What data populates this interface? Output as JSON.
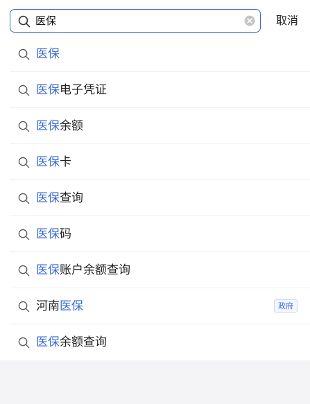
{
  "search": {
    "value": "医保",
    "cancel_label": "取消"
  },
  "suggestions": [
    {
      "highlight": "医保",
      "rest": ""
    },
    {
      "highlight": "医保",
      "rest": "电子凭证"
    },
    {
      "highlight": "医保",
      "rest": "余额"
    },
    {
      "highlight": "医保",
      "rest": "卡"
    },
    {
      "highlight": "医保",
      "rest": "查询"
    },
    {
      "highlight": "医保",
      "rest": "码"
    },
    {
      "highlight": "医保",
      "rest": "账户余额查询"
    },
    {
      "prefix": "河南",
      "highlight": "医保",
      "rest": "",
      "tag": "政府"
    },
    {
      "highlight": "医保",
      "rest": "余额查询"
    }
  ],
  "colors": {
    "accent": "#3a63d8",
    "highlight_text": "#3a6bd6",
    "body_text": "#1f1f1f",
    "background": "#f4f4f6"
  },
  "icons": {
    "search": "search-icon",
    "clear": "clear-icon"
  }
}
